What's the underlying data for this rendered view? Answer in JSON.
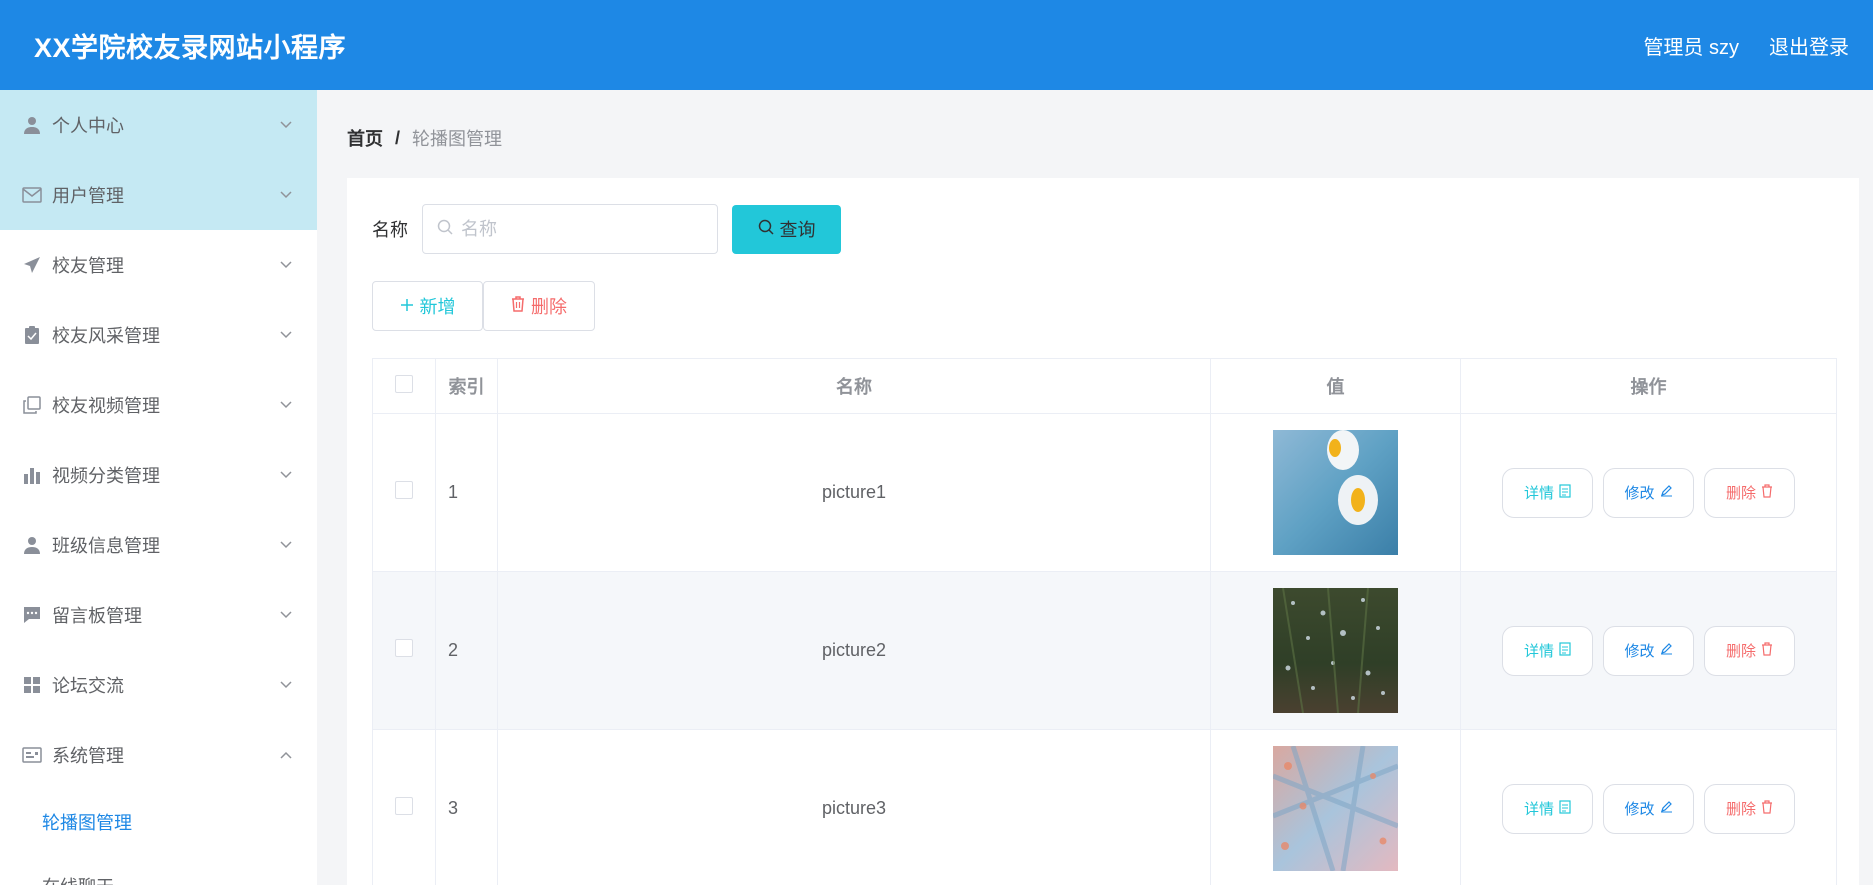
{
  "header": {
    "title": "XX学院校友录网站小程序",
    "user": "管理员 szy",
    "logout": "退出登录"
  },
  "sidebar": {
    "items": [
      {
        "label": "个人中心",
        "icon": "user-icon"
      },
      {
        "label": "用户管理",
        "icon": "mail-icon"
      },
      {
        "label": "校友管理",
        "icon": "send-icon"
      },
      {
        "label": "校友风采管理",
        "icon": "clipboard-icon"
      },
      {
        "label": "校友视频管理",
        "icon": "copy-icon"
      },
      {
        "label": "视频分类管理",
        "icon": "bar-chart-icon"
      },
      {
        "label": "班级信息管理",
        "icon": "user-icon"
      },
      {
        "label": "留言板管理",
        "icon": "message-icon"
      },
      {
        "label": "论坛交流",
        "icon": "grid-icon"
      },
      {
        "label": "系统管理",
        "icon": "card-icon"
      }
    ],
    "sub_items": [
      {
        "label": "轮播图管理"
      },
      {
        "label": "在线聊天"
      }
    ]
  },
  "breadcrumb": {
    "home": "首页",
    "separator": "/",
    "current": "轮播图管理"
  },
  "search": {
    "label": "名称",
    "placeholder": "名称",
    "query_button": "查询"
  },
  "actions": {
    "add": "新增",
    "delete": "删除"
  },
  "table": {
    "headers": {
      "index": "索引",
      "name": "名称",
      "value": "值",
      "actions": "操作"
    },
    "rows": [
      {
        "index": "1",
        "name": "picture1"
      },
      {
        "index": "2",
        "name": "picture2"
      },
      {
        "index": "3",
        "name": "picture3"
      }
    ],
    "row_actions": {
      "detail": "详情",
      "edit": "修改",
      "delete": "删除"
    }
  },
  "colors": {
    "header_bg": "#1e88e5",
    "accent_cyan": "#22c7d9",
    "danger": "#f56c6c",
    "active_menu_bg": "#c5e9f3"
  }
}
